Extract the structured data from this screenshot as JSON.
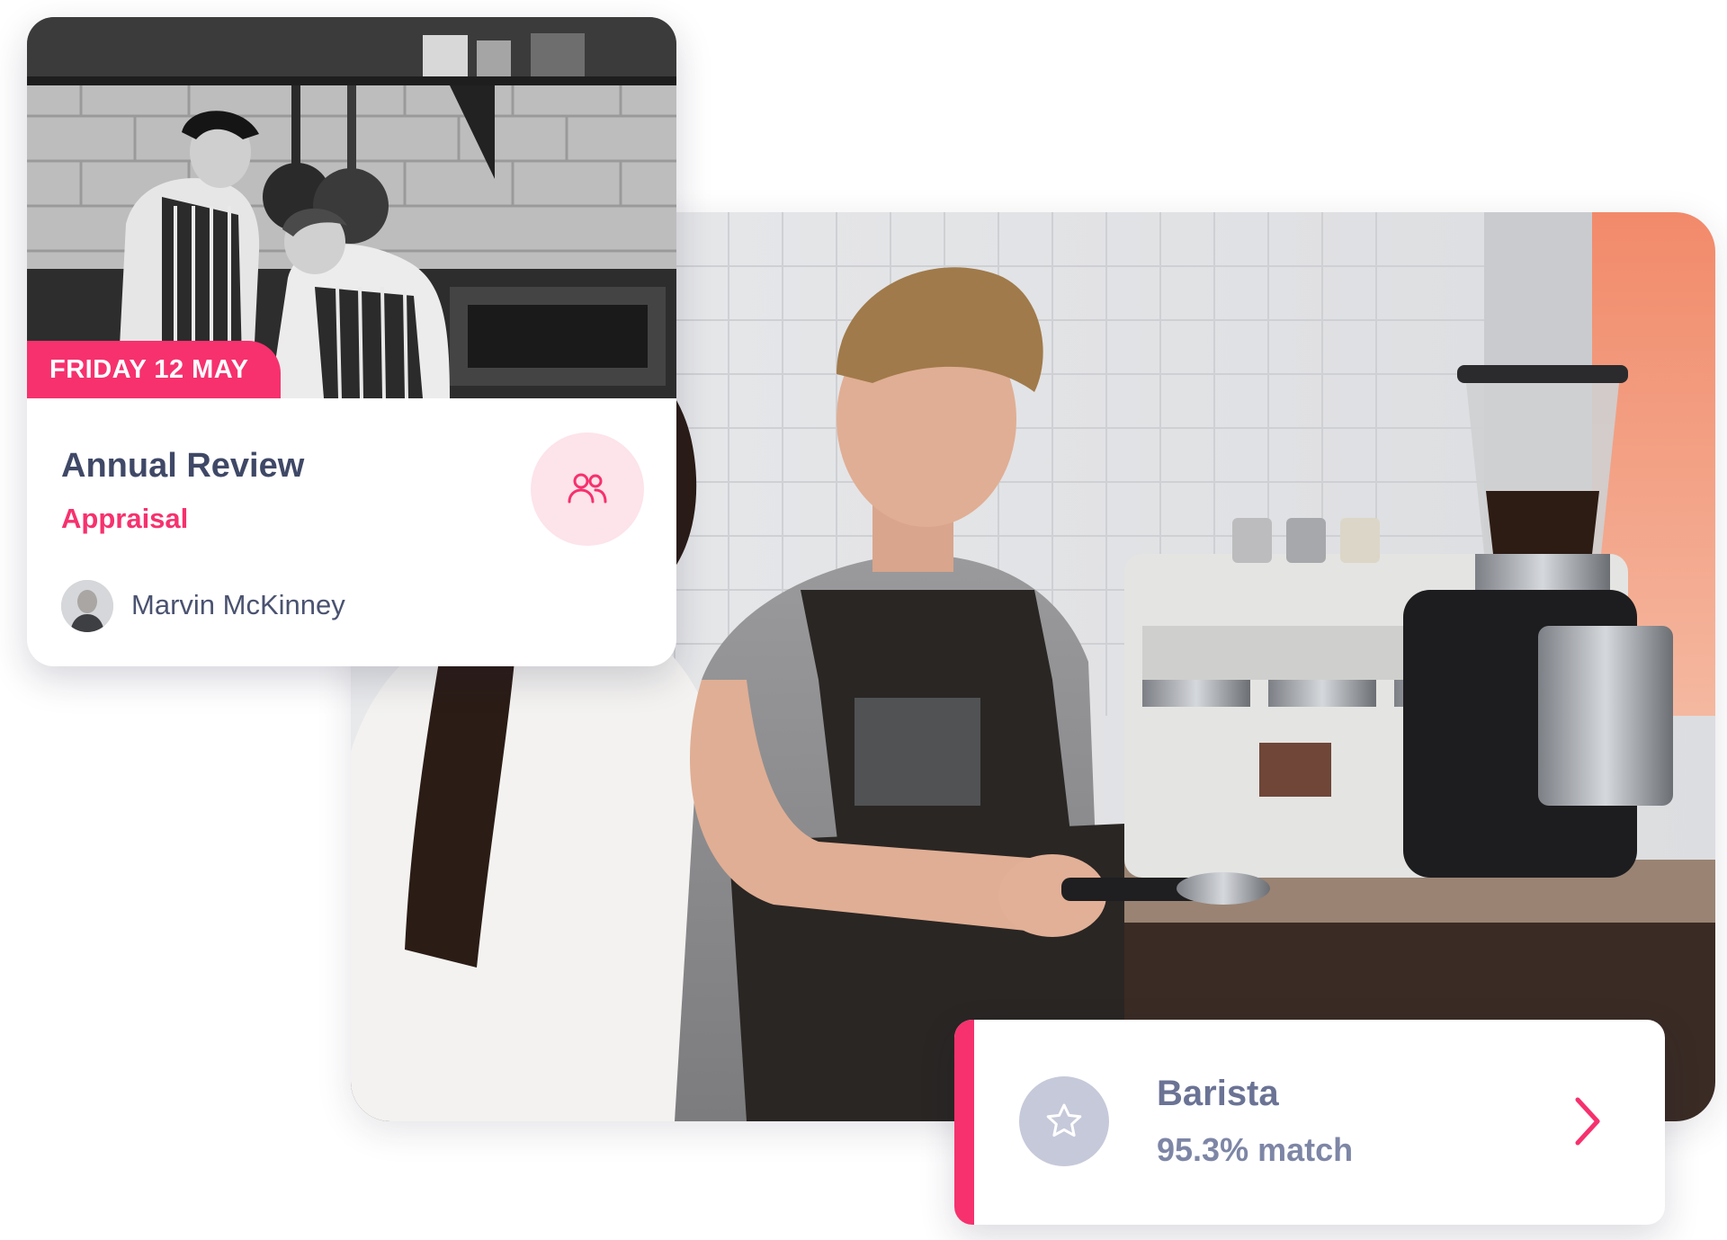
{
  "appointment": {
    "date_label": "FRIDAY 12 MAY",
    "title": "Annual Review",
    "subtitle": "Appraisal",
    "person_name": "Marvin McKinney",
    "icon": "group-icon",
    "photo_description_icon": "kitchen-photo"
  },
  "job_match": {
    "title": "Barista",
    "match": "95.3% match",
    "icon": "star-icon",
    "action_icon": "chevron-right-icon"
  },
  "colors": {
    "accent": "#f6316e",
    "accent_light": "#fde3ea",
    "title_text": "#3f4866",
    "muted_text": "#7e86a6",
    "star_bg": "#c6c9da"
  }
}
